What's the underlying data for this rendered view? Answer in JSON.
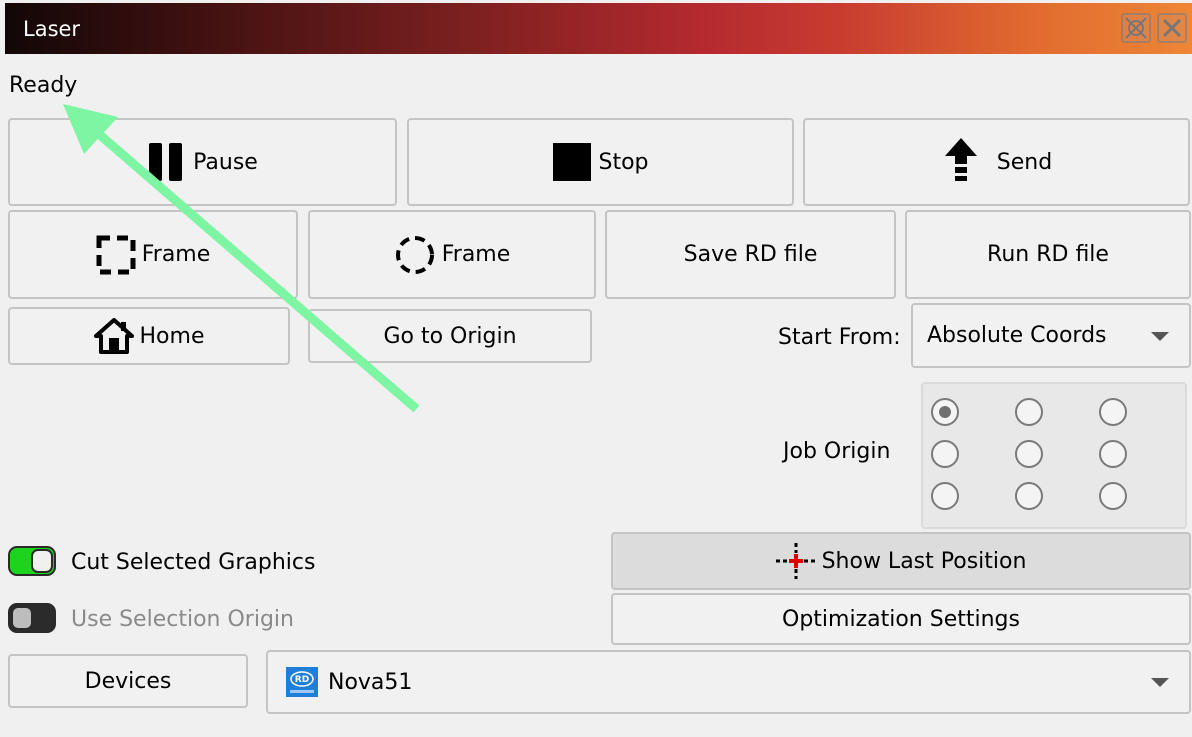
{
  "window": {
    "title": "Laser"
  },
  "status": "Ready",
  "buttons": {
    "pause": "Pause",
    "stop": "Stop",
    "send": "Send",
    "frame_rect": "Frame",
    "frame_circle": "Frame",
    "save_rd": "Save RD file",
    "run_rd": "Run RD file",
    "home": "Home",
    "go_to_origin": "Go to Origin",
    "show_last_position": "Show Last Position",
    "optimization_settings": "Optimization Settings",
    "devices": "Devices"
  },
  "start_from": {
    "label": "Start From:",
    "value": "Absolute Coords"
  },
  "job_origin": {
    "label": "Job Origin",
    "selected_index": 0,
    "count": 9
  },
  "toggles": {
    "cut_selected": {
      "label": "Cut Selected Graphics",
      "on": true
    },
    "use_selection_origin": {
      "label": "Use Selection Origin",
      "on": false
    }
  },
  "device": {
    "name": "Nova51",
    "icon": "ruida-logo-icon",
    "logo_text": "RD"
  },
  "colors": {
    "toggle_on": "#1ed31e",
    "annotation_arrow": "#7df5a2",
    "crosshair": "#e00000"
  }
}
